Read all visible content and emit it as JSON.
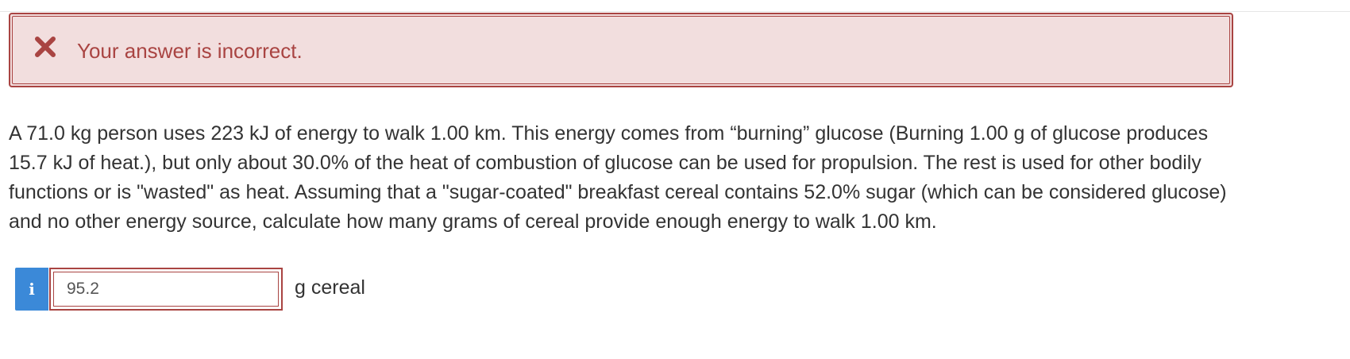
{
  "feedback": {
    "icon": "x-mark-icon",
    "message": "Your answer is incorrect.",
    "color": "#a94442",
    "background": "#f2dede"
  },
  "question": {
    "text": "A 71.0 kg person uses 223 kJ of energy to walk 1.00 km. This energy comes from “burning” glucose (Burning 1.00 g of glucose produces 15.7 kJ of heat.), but only about 30.0% of the heat of combustion of glucose can be used for propulsion. The rest is used for other bodily functions or is \"wasted\" as heat. Assuming that a \"sugar-coated\" breakfast cereal contains 52.0% sugar (which can be considered glucose) and no other energy source, calculate how many grams of cereal provide enough energy to walk 1.00 km."
  },
  "answer": {
    "info_icon": "info-icon",
    "info_glyph": "i",
    "value": "95.2",
    "unit": "g cereal",
    "info_color": "#3b89d8"
  }
}
